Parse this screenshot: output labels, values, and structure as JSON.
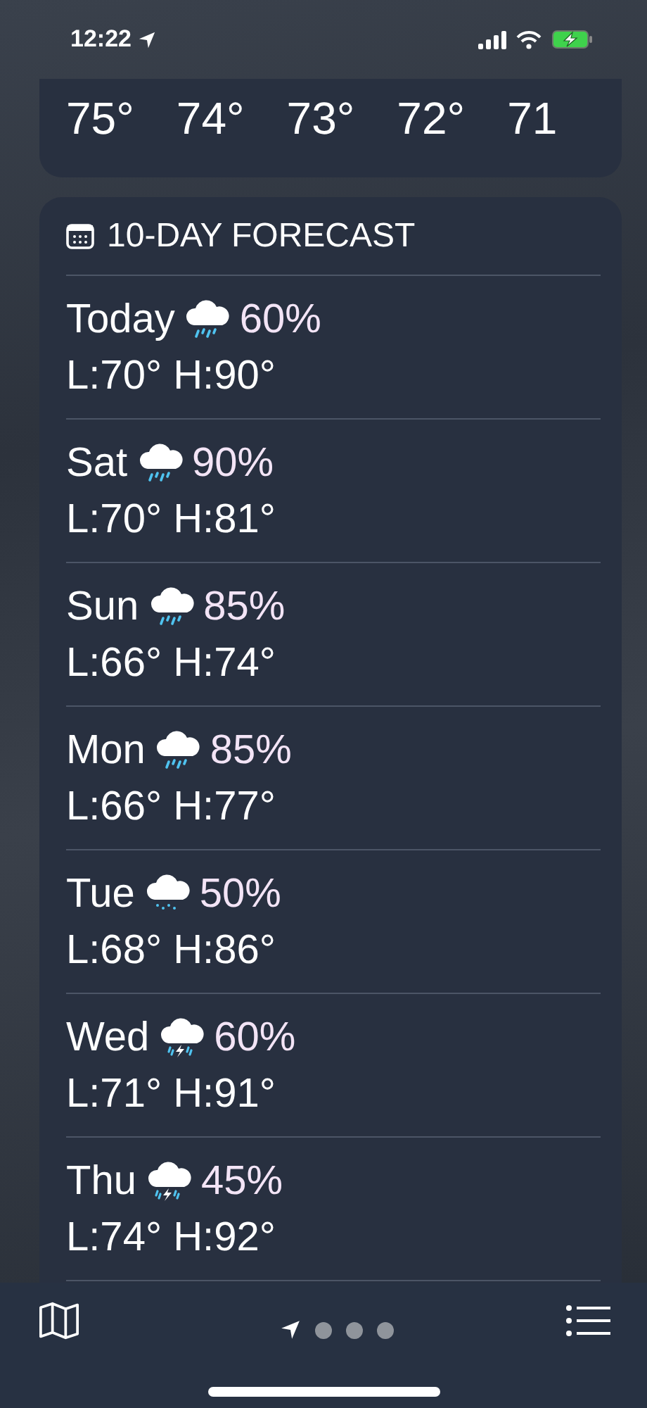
{
  "status_bar": {
    "time": "12:22"
  },
  "hourly": {
    "temps": [
      "75°",
      "74°",
      "73°",
      "72°",
      "71"
    ]
  },
  "forecast": {
    "title": "10-DAY FORECAST",
    "days": [
      {
        "day": "Today",
        "kind": "rain",
        "chance": "60%",
        "range": "L:70° H:90°"
      },
      {
        "day": "Sat",
        "kind": "rain",
        "chance": "90%",
        "range": "L:70° H:81°"
      },
      {
        "day": "Sun",
        "kind": "rain",
        "chance": "85%",
        "range": "L:66° H:74°"
      },
      {
        "day": "Mon",
        "kind": "rain",
        "chance": "85%",
        "range": "L:66° H:77°"
      },
      {
        "day": "Tue",
        "kind": "drizzle",
        "chance": "50%",
        "range": "L:68° H:86°"
      },
      {
        "day": "Wed",
        "kind": "thunder",
        "chance": "60%",
        "range": "L:71° H:91°"
      },
      {
        "day": "Thu",
        "kind": "thunder",
        "chance": "45%",
        "range": "L:74° H:92°"
      }
    ]
  },
  "pages": [
    {
      "kind": "location",
      "selected": true
    },
    {
      "kind": "dot",
      "selected": false
    },
    {
      "kind": "dot",
      "selected": false
    },
    {
      "kind": "dot",
      "selected": false
    }
  ]
}
